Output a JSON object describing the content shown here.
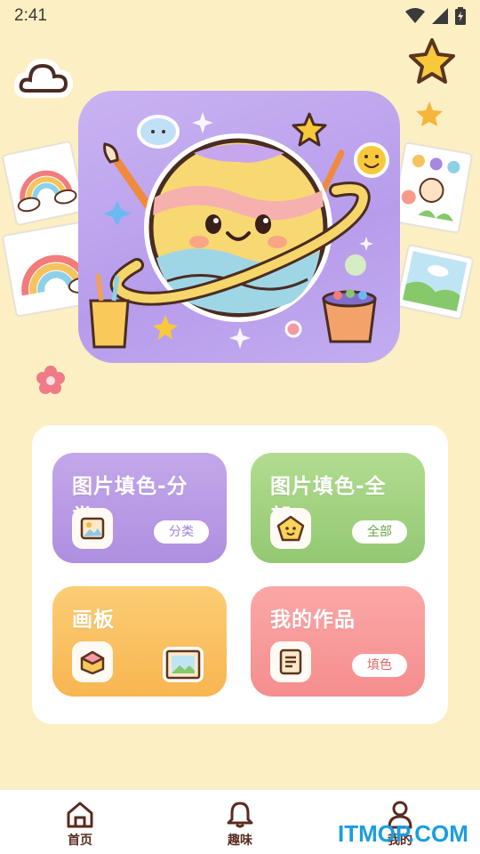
{
  "status": {
    "time": "2:41"
  },
  "menu": {
    "tiles": [
      {
        "title": "图片填色-分类",
        "pill": "分类",
        "icon": "image-icon",
        "color": "#b99be6",
        "pill_color": "#9e7fd6"
      },
      {
        "title": "图片填色-全部",
        "pill": "全部",
        "icon": "smile-pentagon-icon",
        "color": "#a3d27f",
        "pill_color": "#6da34d"
      },
      {
        "title": "画板",
        "icon": "box-icon",
        "icon_right": "picture-frame-icon",
        "color": "#f9c15f"
      },
      {
        "title": "我的作品",
        "pill": "填色",
        "icon": "document-icon",
        "color": "#f89b9b",
        "pill_color": "#e0686a"
      }
    ]
  },
  "nav": {
    "items": [
      {
        "label": "首页",
        "icon": "home-icon"
      },
      {
        "label": "趣味",
        "icon": "bell-icon"
      },
      {
        "label": "我的",
        "icon": "user-icon"
      }
    ]
  },
  "watermark": "ITMOP.COM"
}
